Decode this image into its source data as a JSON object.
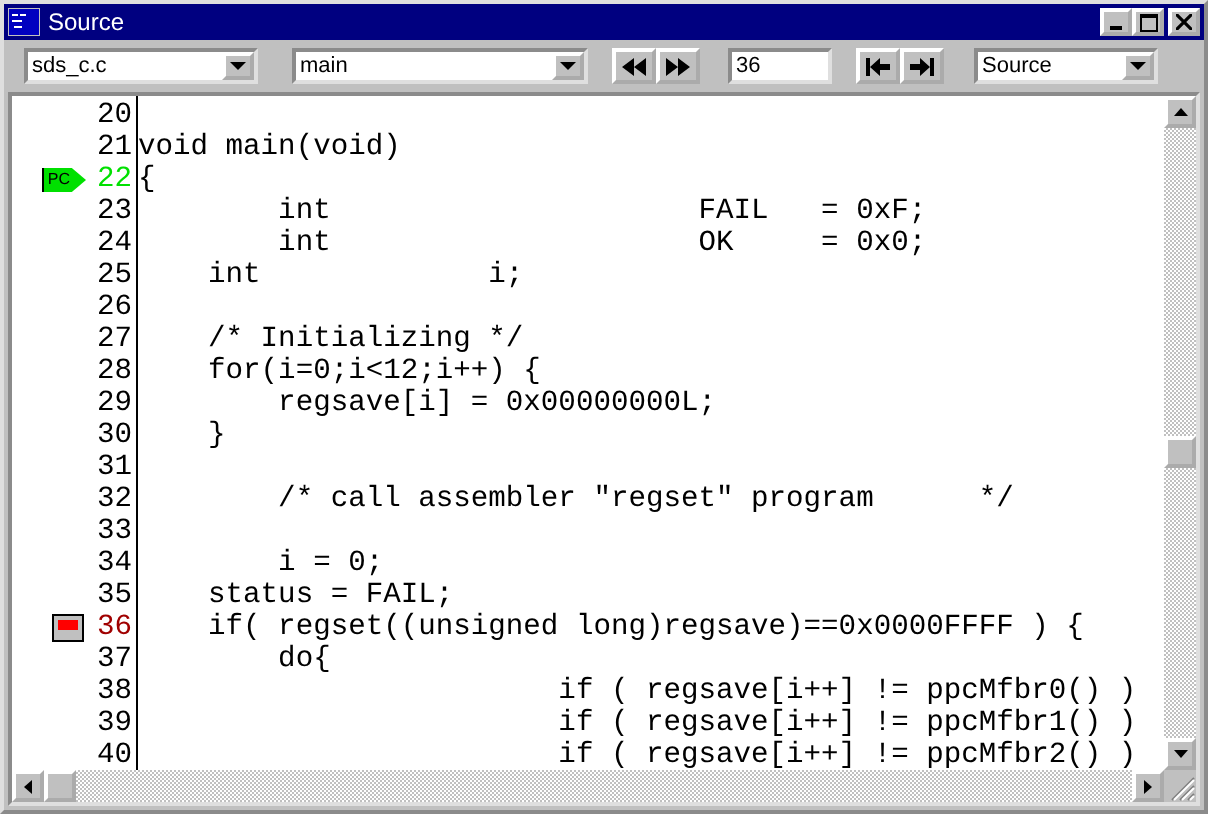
{
  "window": {
    "title": "Source"
  },
  "toolbar": {
    "file": "sds_c.c",
    "function": "main",
    "line": "36",
    "view": "Source"
  },
  "lines": [
    {
      "number": "20"
    },
    {
      "number": "21",
      "code": "void main(void)"
    },
    {
      "number": "22",
      "code": "{",
      "marker": {
        "kind": "pc",
        "label": "PC"
      }
    },
    {
      "number": "23",
      "code": "        int                     FAIL   = 0xF;"
    },
    {
      "number": "24",
      "code": "        int                     OK     = 0x0;"
    },
    {
      "number": "25",
      "code": "    int             i;"
    },
    {
      "number": "26"
    },
    {
      "number": "27",
      "code": "    /* Initializing */"
    },
    {
      "number": "28",
      "code": "    for(i=0;i<12;i++) {"
    },
    {
      "number": "29",
      "code": "        regsave[i] = 0x00000000L;"
    },
    {
      "number": "30",
      "code": "    }"
    },
    {
      "number": "31"
    },
    {
      "number": "32",
      "code": "        /* call assembler \"regset\" program      */"
    },
    {
      "number": "33"
    },
    {
      "number": "34",
      "code": "        i = 0;"
    },
    {
      "number": "35",
      "code": "    status = FAIL;"
    },
    {
      "number": "36",
      "code": "    if( regset((unsigned long)regsave)==0x0000FFFF ) {",
      "marker": {
        "kind": "breakpoint"
      }
    },
    {
      "number": "37",
      "code": "        do{"
    },
    {
      "number": "38",
      "code": "                        if ( regsave[i++] != ppcMfbr0() )"
    },
    {
      "number": "39",
      "code": "                        if ( regsave[i++] != ppcMfbr1() )"
    },
    {
      "number": "40",
      "code": "                        if ( regsave[i++] != ppcMfbr2() )"
    }
  ]
}
